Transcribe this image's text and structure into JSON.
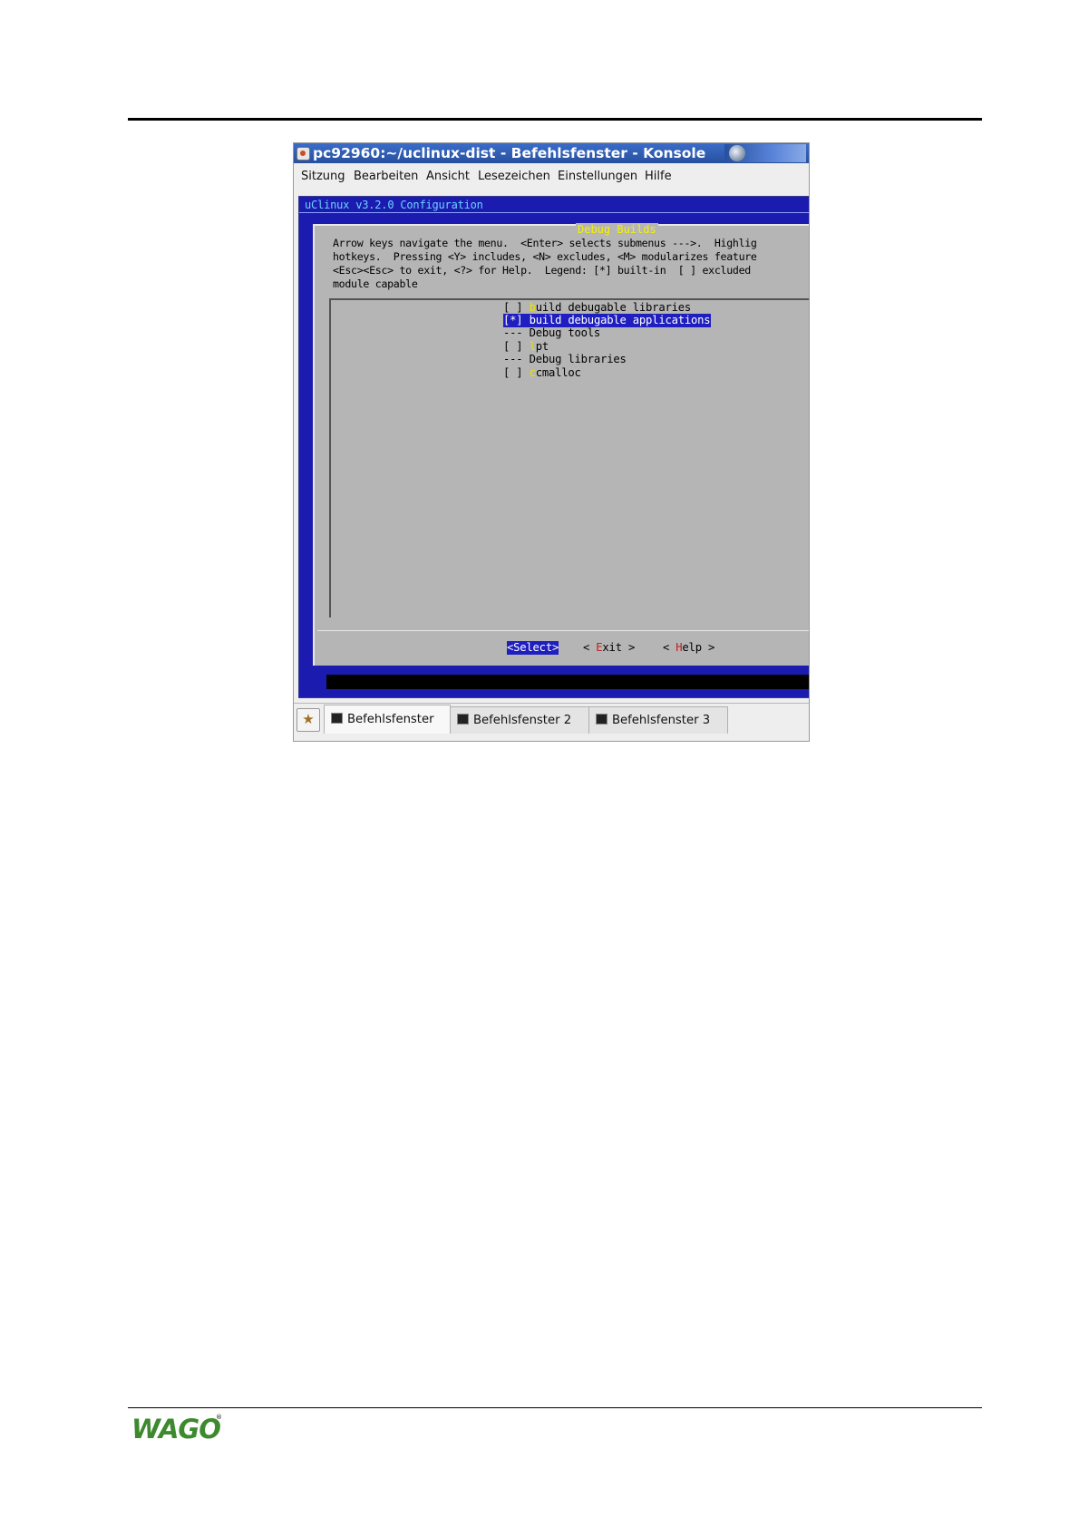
{
  "window": {
    "title": "pc92960:~/uclinux-dist - Befehlsfenster - Konsole"
  },
  "menubar": {
    "items": [
      "Sitzung",
      "Bearbeiten",
      "Ansicht",
      "Lesezeichen",
      "Einstellungen",
      "Hilfe"
    ]
  },
  "terminal": {
    "header": "uClinux v3.2.0 Configuration",
    "dialog_title": "Debug Builds",
    "help_lines": [
      "Arrow keys navigate the menu.  <Enter> selects submenus --->.  Highlig",
      "hotkeys.  Pressing <Y> includes, <N> excludes, <M> modularizes feature",
      "<Esc><Esc> to exit, <?> for Help.  Legend: [*] built-in  [ ] excluded",
      "module capable"
    ],
    "options": [
      {
        "prefix": "[ ] ",
        "hotkey": "b",
        "rest": "uild debugable libraries"
      },
      {
        "prefix": "[*] ",
        "hotkey": "b",
        "rest": "uild debugable applications"
      },
      {
        "prefix": "--- ",
        "hotkey": "",
        "rest": "Debug tools"
      },
      {
        "prefix": "[ ] ",
        "hotkey": "l",
        "rest": "pt"
      },
      {
        "prefix": "--- ",
        "hotkey": "",
        "rest": "Debug libraries"
      },
      {
        "prefix": "[ ] ",
        "hotkey": "c",
        "rest": "cmalloc"
      }
    ],
    "buttons": {
      "select": "<Select>",
      "exit_left": "< ",
      "exit_hot": "E",
      "exit_rest": "xit >",
      "help_left": "< ",
      "help_hot": "H",
      "help_rest": "elp >"
    }
  },
  "tabs": [
    "Befehlsfenster",
    "Befehlsfenster 2",
    "Befehlsfenster 3"
  ],
  "logo": {
    "text": "WAGO",
    "color": "#3d8a2e"
  },
  "colors": {
    "titlebar": "#3160b8",
    "terminal_bg": "#1b1bb0",
    "dialog_bg": "#b5b5b5",
    "hotkey": "#e9e200"
  }
}
